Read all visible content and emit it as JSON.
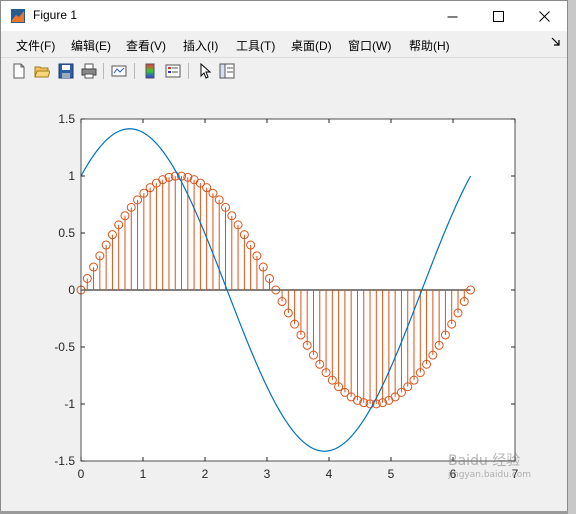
{
  "window": {
    "title": "Figure 1"
  },
  "menu": {
    "items": [
      "文件(F)",
      "编辑(E)",
      "查看(V)",
      "插入(I)",
      "工具(T)",
      "桌面(D)",
      "窗口(W)",
      "帮助(H)"
    ]
  },
  "toolbar": {
    "icons": [
      "new-figure-icon",
      "open-file-icon",
      "save-icon",
      "print-icon",
      "link-plot-icon",
      "colorbar-icon",
      "legend-icon",
      "edit-plot-arrow-icon",
      "property-inspector-icon"
    ]
  },
  "colors": {
    "sine_line": "#0072BD",
    "stem": "#D95319",
    "axis": "#262626"
  },
  "watermark": {
    "text": "Baidu 经验",
    "sub": "jingyan.baidu.com"
  },
  "chart_data": {
    "type": "line",
    "xlim": [
      0,
      7
    ],
    "ylim": [
      -1.5,
      1.5
    ],
    "xticks": [
      "0",
      "1",
      "2",
      "3",
      "4",
      "5",
      "6",
      "7"
    ],
    "yticks": [
      "1.5",
      "1",
      "0.5",
      "0",
      "-0.5",
      "-1",
      "-1.5"
    ],
    "grid": false,
    "series": [
      {
        "kind": "line",
        "function": "sin(x)+cos(x)",
        "x_range": [
          0,
          6.2832
        ],
        "color": "#0072BD"
      },
      {
        "kind": "stem",
        "function": "sin(x)",
        "x_range": [
          0,
          6.2832
        ],
        "n_points": 63,
        "color": "#D95319"
      }
    ]
  }
}
